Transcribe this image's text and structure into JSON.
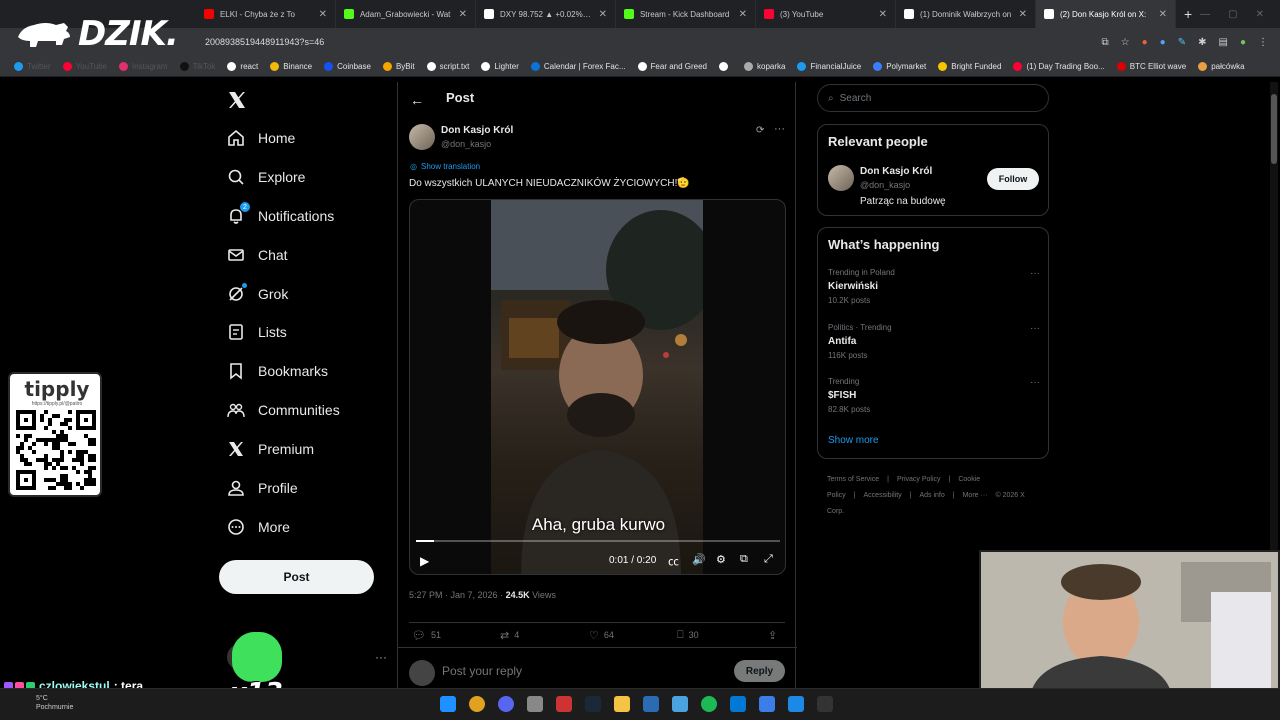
{
  "browser": {
    "tabs": [
      {
        "title": "ELKI - Chyba że z To",
        "color": "#f70000"
      },
      {
        "title": "Adam_Grabowiecki - Wat",
        "color": "#53fc18"
      },
      {
        "title": "DXY 98.752 ▲ +0.02% Be",
        "color": "#ffffff"
      },
      {
        "title": "Stream - Kick Dashboard",
        "color": "#53fc18"
      },
      {
        "title": "(3) YouTube",
        "color": "#ff0033"
      },
      {
        "title": "(1) Dominik Wałbrzych on",
        "color": "#ffffff"
      },
      {
        "title": "(2) Don Kasjo Król on X:",
        "color": "#ffffff"
      }
    ],
    "new_tab": "+",
    "url": "2008938519448911943?s=46",
    "bookmarks": [
      {
        "label": "Twitter",
        "faded": true
      },
      {
        "label": "YouTube",
        "faded": true
      },
      {
        "label": "Instagram",
        "faded": true
      },
      {
        "label": "TikTok",
        "faded": true
      },
      {
        "label": "react"
      },
      {
        "label": "Binance"
      },
      {
        "label": "Coinbase"
      },
      {
        "label": "ByBit"
      },
      {
        "label": "script.txt"
      },
      {
        "label": "Lighter"
      },
      {
        "label": "Calendar | Forex Fac..."
      },
      {
        "label": "Fear and Greed"
      },
      {
        "label": ""
      },
      {
        "label": "koparka"
      },
      {
        "label": "FinancialJuice"
      },
      {
        "label": "Polymarket"
      },
      {
        "label": "Bright Funded"
      },
      {
        "label": "(1) Day Trading Boo..."
      },
      {
        "label": "BTC Elliot wave"
      },
      {
        "label": "pałcówka"
      }
    ]
  },
  "overlay": {
    "dzik": "DZIK.",
    "tipply_logo": "tipply",
    "tipply_url": "https://tipply.pl/@patiro",
    "chat_user": "czlowiekstul",
    "chat_msg": ": tera",
    "emote_count": "x13"
  },
  "nav": {
    "items": [
      {
        "label": "Home",
        "icon": "home-icon"
      },
      {
        "label": "Explore",
        "icon": "search-icon"
      },
      {
        "label": "Notifications",
        "icon": "bell-icon"
      },
      {
        "label": "Chat",
        "icon": "mail-icon"
      },
      {
        "label": "Grok",
        "icon": "grok-icon"
      },
      {
        "label": "Lists",
        "icon": "list-icon"
      },
      {
        "label": "Bookmarks",
        "icon": "bookmark-icon"
      },
      {
        "label": "Communities",
        "icon": "communities-icon"
      },
      {
        "label": "Premium",
        "icon": "x-icon"
      },
      {
        "label": "Profile",
        "icon": "person-icon"
      },
      {
        "label": "More",
        "icon": "more-circle-icon"
      }
    ],
    "notifications_badge": "2",
    "post_button": "Post"
  },
  "post": {
    "header_title": "Post",
    "author_name": "Don Kasjo Król",
    "author_handle": "@don_kasjo",
    "show_translation": "Show translation",
    "text": "Do wszystkich ULANYCH NIEUDACZNIKÓW ŻYCIOWYCH!🫡",
    "video": {
      "caption": "Aha, gruba kurwo",
      "time": "0:01 / 0:20",
      "progress": 0.05
    },
    "timestamp": "5:27 PM · Jan 7, 2026 · ",
    "views_count": "24.5K",
    "views_label": " Views",
    "replies": "51",
    "reposts": "4",
    "likes": "64",
    "bookmarks": "30",
    "reply_placeholder": "Post your reply",
    "reply_button": "Reply"
  },
  "sidebar": {
    "search_placeholder": "Search",
    "relevant_title": "Relevant people",
    "relevant_name": "Don Kasjo Król",
    "relevant_handle": "@don_kasjo",
    "relevant_bio": "Patrząc na budowę",
    "follow_label": "Follow",
    "happening_title": "What’s happening",
    "trends": [
      {
        "meta": "Trending in Poland",
        "name": "Kierwiński",
        "count": "10.2K posts"
      },
      {
        "meta": "Politics · Trending",
        "name": "Antifa",
        "count": "116K posts"
      },
      {
        "meta": "Trending",
        "name": "$FISH",
        "count": "82.8K posts"
      }
    ],
    "show_more": "Show more",
    "footer": [
      "Terms of Service",
      "|",
      "Privacy Policy",
      "|",
      "Cookie Policy",
      "|",
      "Accessibility",
      "|",
      "Ads info",
      "|",
      "More ···",
      "© 2026 X Corp."
    ]
  },
  "taskbar": {
    "weather_temp": "5°C",
    "weather_desc": "Pochmurnie"
  }
}
